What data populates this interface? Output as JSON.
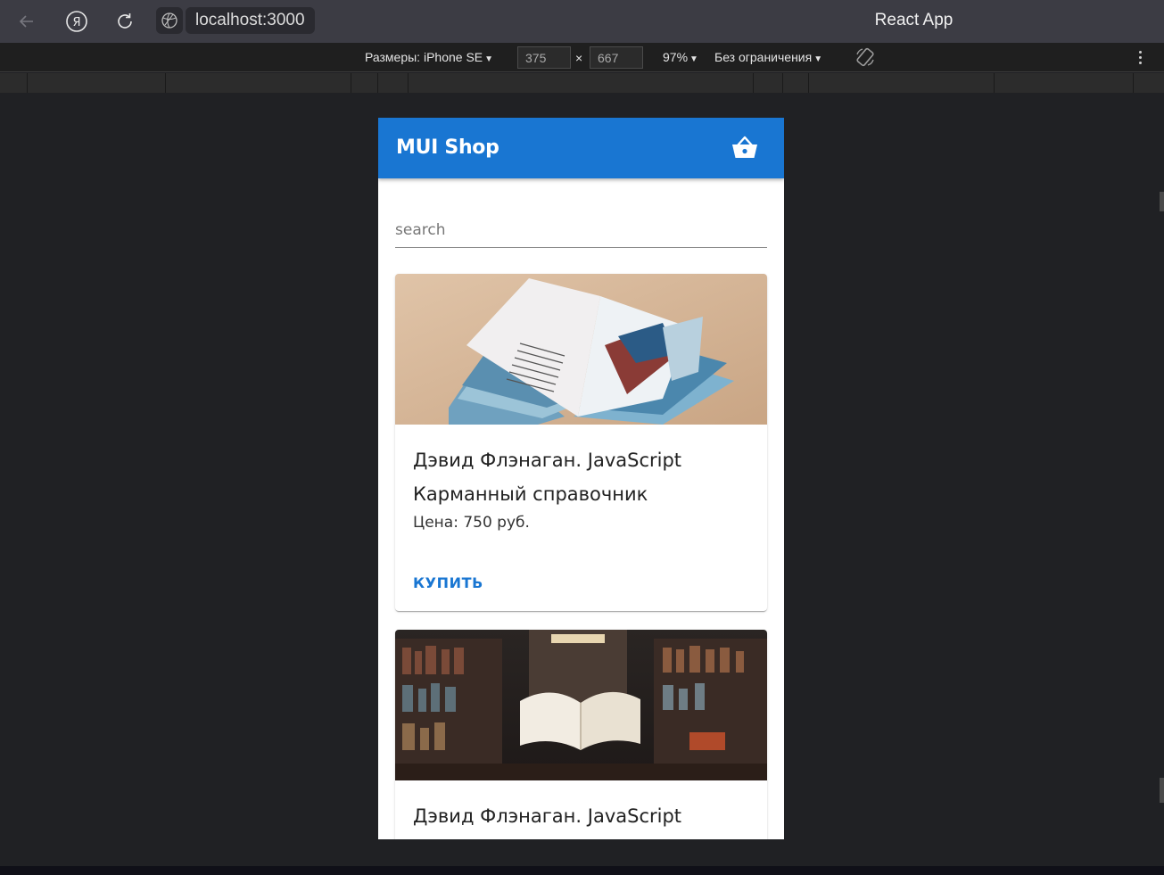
{
  "browser": {
    "url": "localhost:3000",
    "window_title": "React App"
  },
  "devtools": {
    "dimensions_label": "Размеры: iPhone SE",
    "width": "375",
    "height": "667",
    "times": "×",
    "zoom": "97%",
    "throttle": "Без ограничения"
  },
  "app": {
    "title": "MUI Shop",
    "search_placeholder": "search",
    "primary_color": "#1976d2",
    "cart_icon": "shopping-basket-icon",
    "products": [
      {
        "title": "Дэвид Флэнаган. JavaScript Карманный справочник",
        "price": "Цена: 750 руб.",
        "buy_label": "КУПИТЬ"
      },
      {
        "title": "Дэвид Флэнаган. JavaScript"
      }
    ]
  }
}
